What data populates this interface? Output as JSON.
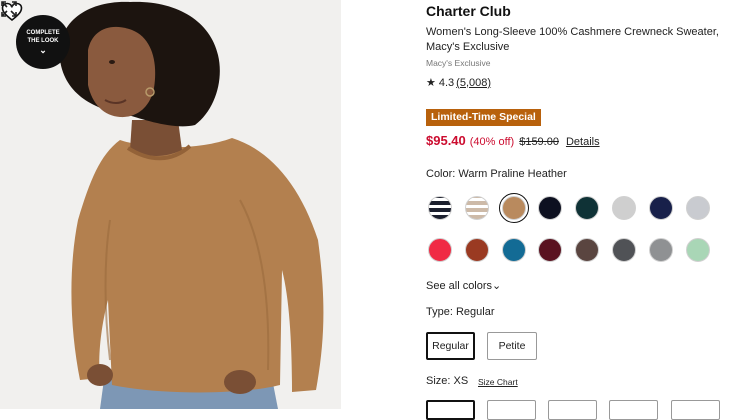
{
  "image": {
    "badge_line1": "COMPLETE",
    "badge_line2": "THE LOOK",
    "badge_chevron": "⌄",
    "icons": [
      "heart-icon",
      "expand-icon"
    ]
  },
  "product": {
    "brand": "Charter Club",
    "title": "Women's Long-Sleeve 100% Cashmere Crewneck Sweater, Macy's Exclusive",
    "seller": "Macy's Exclusive",
    "rating_star": "★",
    "rating": "4.3",
    "review_count": "(5,008)",
    "promo_badge": "Limited-Time Special",
    "sale_price": "$95.40",
    "discount": "(40% off)",
    "original_price": "$159.00",
    "details_link": "Details"
  },
  "color": {
    "label": "Color: Warm Praline Heather",
    "swatches": [
      {
        "color": "#1b1f2e",
        "pattern": "stripe-navy"
      },
      {
        "color": "#cdbaa8",
        "pattern": "stripe-tan"
      },
      {
        "color": "#b98a5e",
        "selected": true
      },
      {
        "color": "#0d1020"
      },
      {
        "color": "#0f3236"
      },
      {
        "color": "#cfcfcf"
      },
      {
        "color": "#18204a"
      },
      {
        "color": "#c9cbd0"
      },
      {
        "color": "#f02a44"
      },
      {
        "color": "#9a3a22"
      },
      {
        "color": "#136b95"
      },
      {
        "color": "#5a1220"
      },
      {
        "color": "#5a4540"
      },
      {
        "color": "#505256"
      },
      {
        "color": "#8f9193"
      },
      {
        "color": "#a9d6b6"
      }
    ],
    "see_all": "See all colors",
    "see_all_chevron": "⌄"
  },
  "type": {
    "label": "Type: Regular",
    "options": [
      "Regular",
      "Petite"
    ]
  },
  "size": {
    "label": "Size: XS",
    "chart_link": "Size Chart"
  }
}
